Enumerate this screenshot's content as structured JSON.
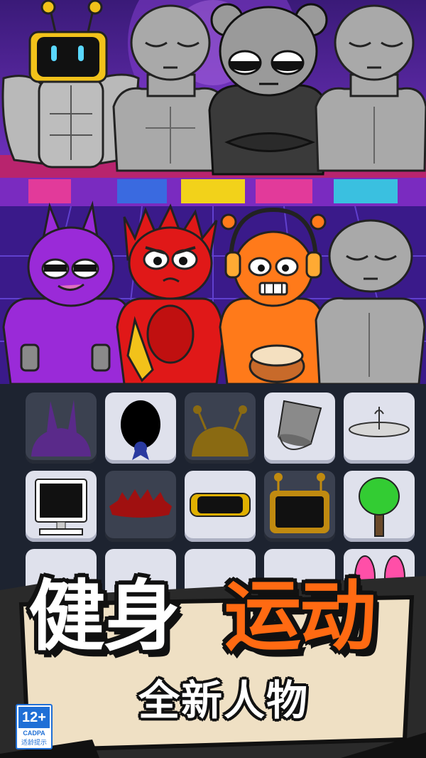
{
  "stage": {
    "back_row": [
      "robot-character",
      "gray-character-left",
      "black-bear-character",
      "gray-character-right"
    ],
    "front_row": [
      "purple-horned-character",
      "red-spiky-character",
      "orange-headphones-drummer",
      "gray-character-front"
    ]
  },
  "palette": {
    "items": [
      {
        "name": "horns-item",
        "icon": "horns-icon",
        "style": "dark",
        "color": "#5a2a8a"
      },
      {
        "name": "medal-item",
        "icon": "medal-icon",
        "style": "light",
        "color": "#000000"
      },
      {
        "name": "antenna-hair-item",
        "icon": "antenna-hair-icon",
        "style": "dark",
        "color": "#8a6a12"
      },
      {
        "name": "bucket-item",
        "icon": "bucket-icon",
        "style": "light",
        "color": "#8a8a8a"
      },
      {
        "name": "cymbal-item",
        "icon": "cymbal-icon",
        "style": "light",
        "color": "#d8d8d8"
      },
      {
        "name": "computer-item",
        "icon": "computer-monitor-icon",
        "style": "light",
        "color": "#111111"
      },
      {
        "name": "spiky-crown-item",
        "icon": "spiky-crown-icon",
        "style": "dark",
        "color": "#a01010"
      },
      {
        "name": "visor-item",
        "icon": "visor-icon",
        "style": "light",
        "color": "#e0b000"
      },
      {
        "name": "robot-head-item",
        "icon": "robot-head-icon",
        "style": "dark",
        "color": "#c08a10"
      },
      {
        "name": "tree-item",
        "icon": "tree-icon",
        "style": "light",
        "color": "#33cc33"
      }
    ]
  },
  "banner": {
    "title_part1": "健身",
    "title_part2": "运动",
    "subtitle": "全新人物",
    "title_color": "#ffffff",
    "accent_color": "#ff6a12"
  },
  "age_rating": {
    "age": "12+",
    "org": "CADPA",
    "tip": "适龄提示",
    "color": "#1f6fd6"
  }
}
